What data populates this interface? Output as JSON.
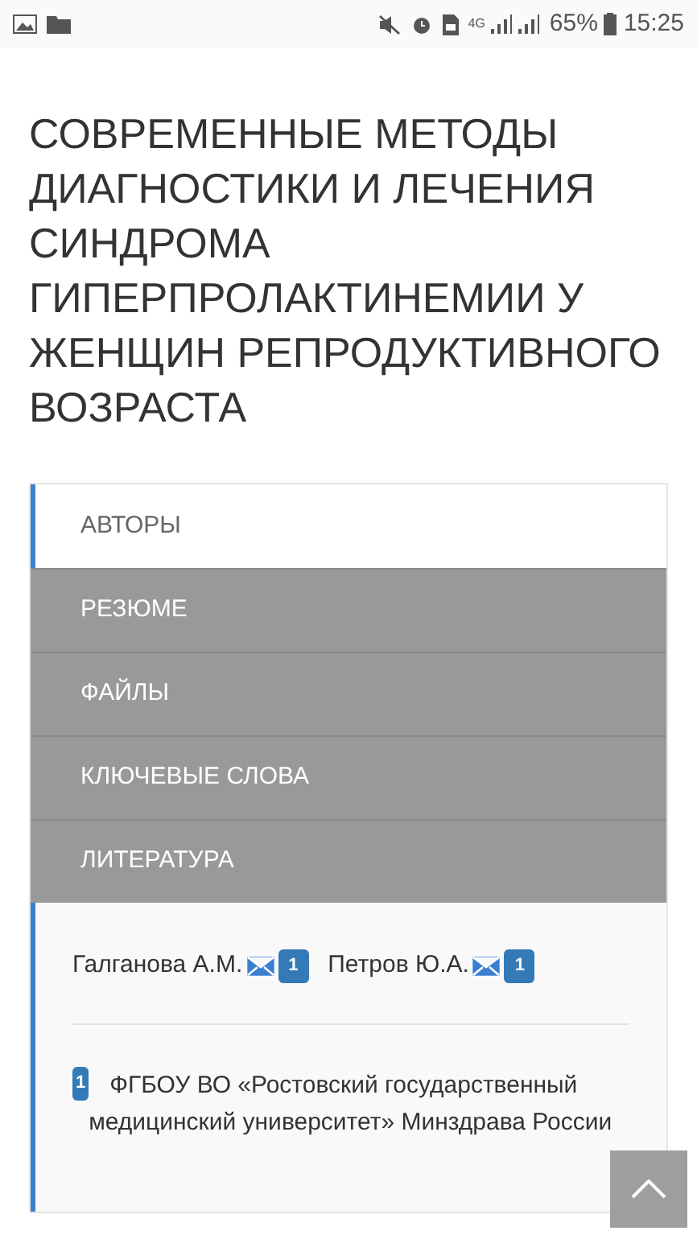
{
  "status_bar": {
    "network": "4G",
    "battery": "65%",
    "time": "15:25"
  },
  "title": "СОВРЕМЕННЫЕ МЕТОДЫ ДИАГНОСТИКИ И ЛЕЧЕНИЯ СИНДРОМА ГИПЕРПРОЛАКТИНЕМИИ У ЖЕНЩИН РЕПРОДУКТИВНОГО ВОЗРАСТА",
  "tabs": [
    {
      "label": "АВТОРЫ",
      "selected": true
    },
    {
      "label": "РЕЗЮМЕ",
      "selected": false
    },
    {
      "label": "ФАЙЛЫ",
      "selected": false
    },
    {
      "label": "КЛЮЧЕВЫЕ СЛОВА",
      "selected": false
    },
    {
      "label": "ЛИТЕРАТУРА",
      "selected": false
    }
  ],
  "authors": [
    {
      "name": "Галганова А.М.",
      "affiliation": "1"
    },
    {
      "name": "Петров Ю.А.",
      "affiliation": "1"
    }
  ],
  "affiliations": [
    {
      "number": "1",
      "text": "ФГБОУ ВО «Ростовский государственный медицинский университет» Минздрава России"
    }
  ]
}
